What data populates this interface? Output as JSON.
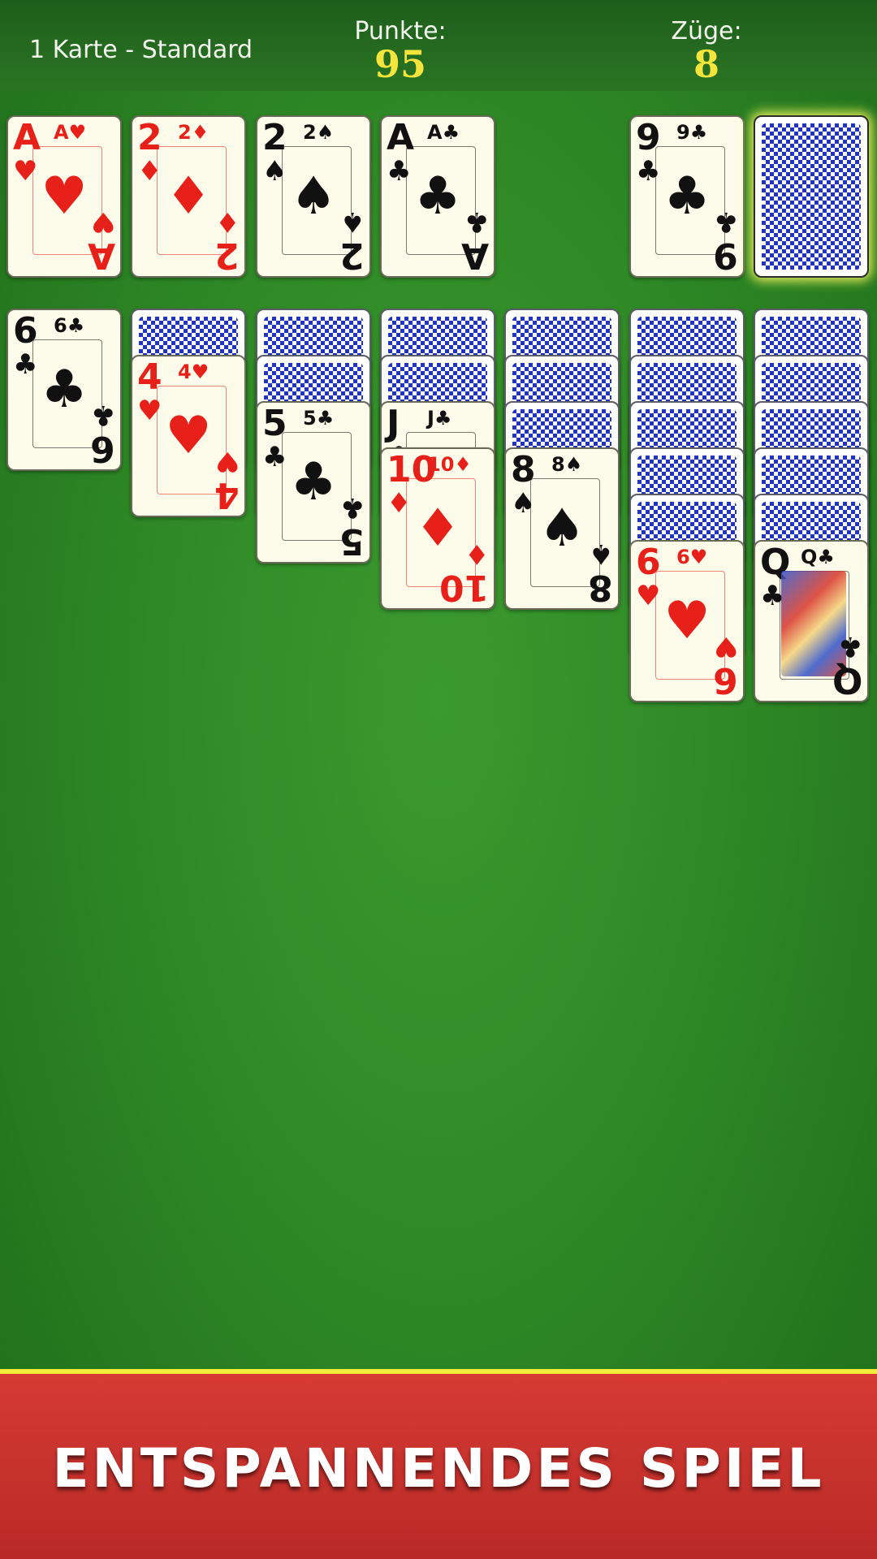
{
  "header": {
    "mode": "1 Karte - Standard",
    "score_label": "Punkte:",
    "score_value": "95",
    "moves_label": "Züge:",
    "moves_value": "8"
  },
  "foundations": [
    {
      "rank": "A",
      "suit": "♥",
      "color": "red"
    },
    {
      "rank": "2",
      "suit": "♦",
      "color": "red"
    },
    {
      "rank": "2",
      "suit": "♠",
      "color": "black"
    },
    {
      "rank": "A",
      "suit": "♣",
      "color": "black"
    }
  ],
  "waste": {
    "rank": "9",
    "suit": "♣",
    "color": "black"
  },
  "tableau": [
    {
      "hidden": 0,
      "top": {
        "rank": "6",
        "suit": "♣",
        "color": "black"
      }
    },
    {
      "hidden": 1,
      "top": {
        "rank": "4",
        "suit": "♥",
        "color": "red"
      }
    },
    {
      "hidden": 2,
      "top": {
        "rank": "5",
        "suit": "♣",
        "color": "black"
      }
    },
    {
      "hidden": 2,
      "partial": {
        "rank": "J",
        "suit": "♣",
        "color": "black"
      },
      "top": {
        "rank": "10",
        "suit": "♦",
        "color": "red"
      }
    },
    {
      "hidden": 3,
      "top": {
        "rank": "8",
        "suit": "♠",
        "color": "black"
      }
    },
    {
      "hidden": 5,
      "top": {
        "rank": "6",
        "suit": "♥",
        "color": "red"
      }
    },
    {
      "hidden": 5,
      "top": {
        "rank": "Q",
        "suit": "♣",
        "color": "black"
      }
    }
  ],
  "banner": {
    "text": "ENTSPANNENDES SPIEL"
  }
}
